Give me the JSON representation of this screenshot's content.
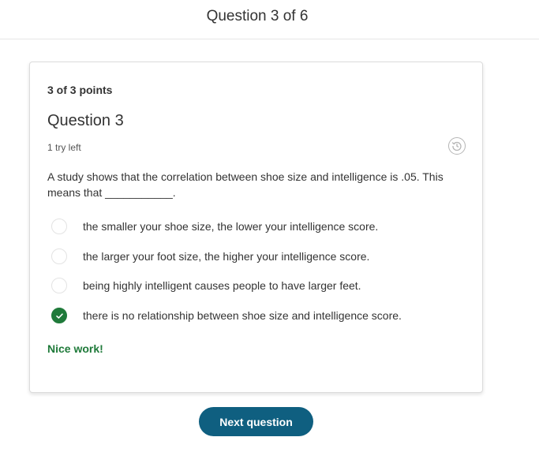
{
  "header": {
    "title": "Question 3 of 6"
  },
  "question": {
    "points": "3 of 3 points",
    "title": "Question 3",
    "tries": "1 try left",
    "prompt": "A study shows that the correlation between shoe size and intelligence is .05. This means that ___________.",
    "history_icon": "history-icon",
    "options": [
      {
        "label": "the smaller your shoe size, the lower your intelligence score.",
        "selected": false
      },
      {
        "label": "the larger your foot size, the higher your intelligence score.",
        "selected": false
      },
      {
        "label": "being highly intelligent causes people to have larger feet.",
        "selected": false
      },
      {
        "label": "there is no relationship between shoe size and intelligence score.",
        "selected": true
      }
    ],
    "feedback": "Nice work!"
  },
  "actions": {
    "next_label": "Next question"
  },
  "colors": {
    "success": "#1f7a3a",
    "primary_button": "#0f5f80"
  }
}
